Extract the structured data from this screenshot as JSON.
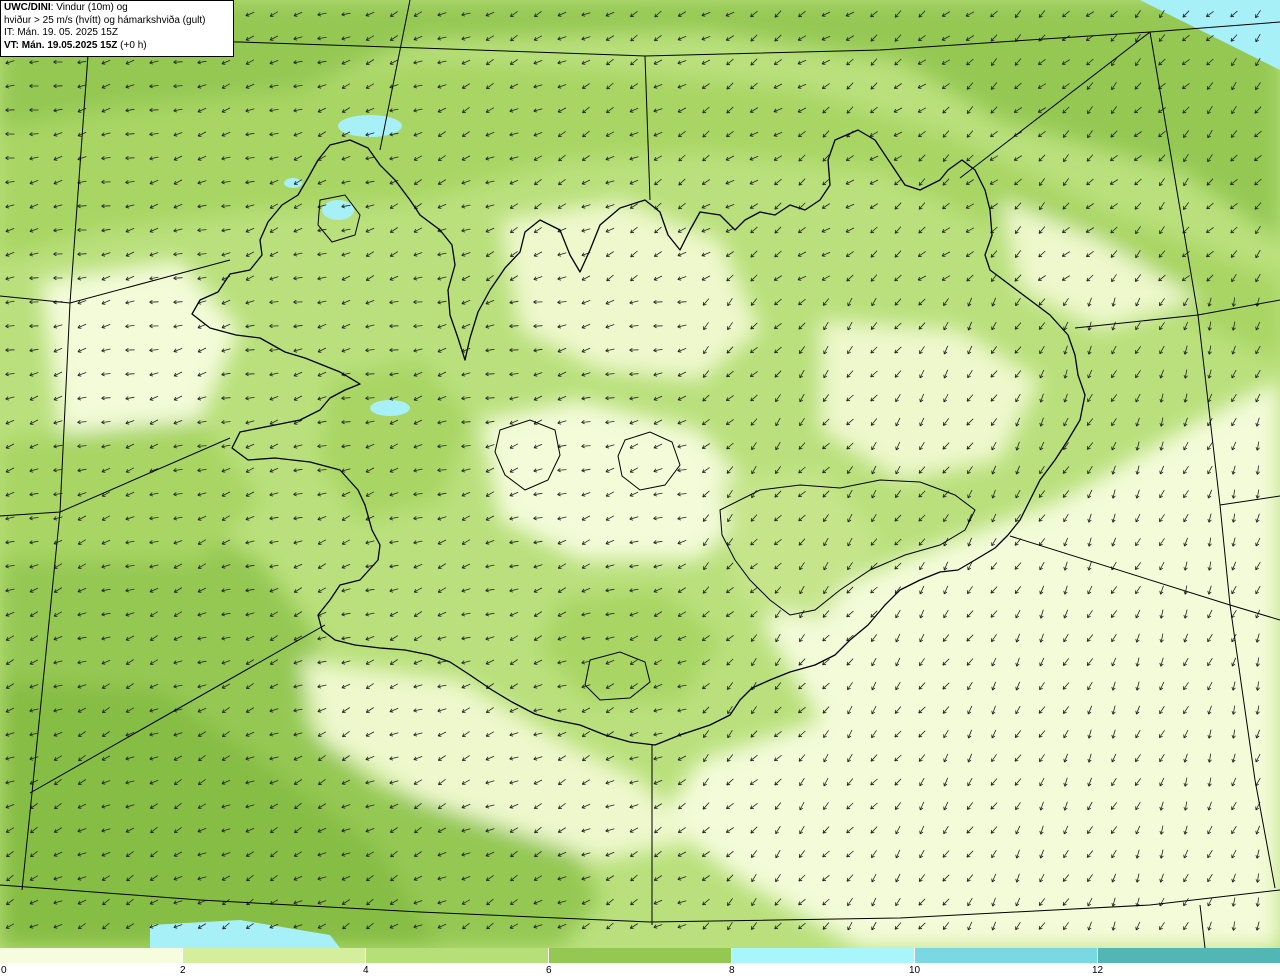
{
  "header": {
    "model": "UWC/DINI",
    "variable": ": Vindur (10m) og",
    "line2": "hviður > 25 m/s (hvítt) og hámarkshviða (gult)",
    "issue_time": "IT: Mán. 19. 05. 2025 15Z",
    "valid_label": "VT: Mán. 19.05.2025 15Z",
    "valid_offset": " (+0 h)"
  },
  "colors": {
    "land_outline": "#000000",
    "grid_line": "#000000",
    "arrow": "#222222",
    "lake": "#a8f0f8"
  },
  "legend": {
    "ticks": [
      "0",
      "2",
      "4",
      "6",
      "8",
      "10",
      "12"
    ],
    "colors": [
      "#f6fcde",
      "#d5ee9e",
      "#b6df78",
      "#94c852",
      "#a8f6fc",
      "#7ad8e2",
      "#52b6b4"
    ]
  },
  "icons": {
    "wind_arrow": "arrow-icon"
  }
}
